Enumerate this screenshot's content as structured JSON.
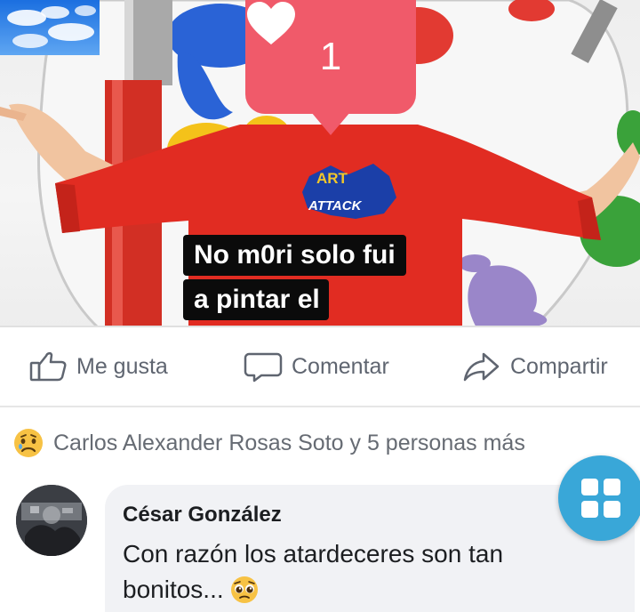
{
  "notification": {
    "like_count": "1",
    "icon": "heart-icon",
    "color": "#f05a6a"
  },
  "photo": {
    "shirt_logo": "ART ATTACK",
    "caption_line_1": "No m0ri solo fui",
    "caption_line_2": "a pintar el",
    "caption_emoji": "sky-emoji"
  },
  "actions": {
    "like_label": "Me gusta",
    "comment_label": "Comentar",
    "share_label": "Compartir"
  },
  "reactions": {
    "icon": "sad-face-icon",
    "summary": "Carlos Alexander Rosas Soto y 5 personas más"
  },
  "comment": {
    "author": "César González",
    "text": "Con razón los atardeceres son tan",
    "text_end": "bonitos...",
    "emoji": "pleading-face-emoji"
  },
  "fab": {
    "icon": "grid-menu-icon",
    "color": "#39a7d8"
  }
}
